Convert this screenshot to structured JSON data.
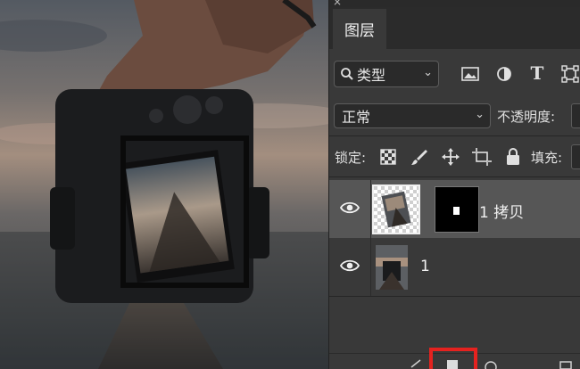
{
  "canvas": {
    "description_icon": "photo-canvas"
  },
  "layers_panel": {
    "close_glyph": "×",
    "tab_label": "图层",
    "filter": {
      "selected": "类型",
      "icon": "search-icon"
    },
    "filter_icons": [
      "image-filter-icon",
      "adjustment-filter-icon",
      "type-filter-icon",
      "shape-filter-icon"
    ],
    "type_glyph": "T",
    "blend_mode": {
      "selected": "正常"
    },
    "opacity_label": "不透明度:",
    "lock_label": "锁定:",
    "lock_icons": [
      "lock-transparent-pixels-icon",
      "lock-image-pixels-icon",
      "lock-position-icon",
      "lock-artboard-icon",
      "lock-all-icon"
    ],
    "fill_label": "填充:",
    "layers": [
      {
        "name": "1 拷贝",
        "visible": true,
        "selected": true,
        "has_mask": true
      },
      {
        "name": "1",
        "visible": true,
        "selected": false,
        "has_mask": false
      }
    ],
    "highlight_color": "#e5221f"
  }
}
